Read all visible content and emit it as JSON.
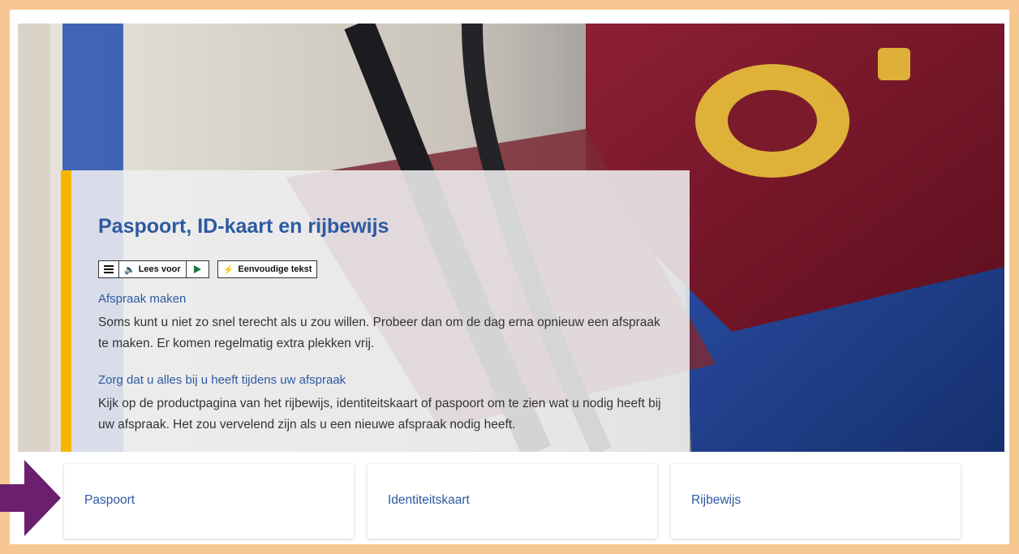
{
  "hero": {
    "title": "Paspoort, ID-kaart en rijbewijs",
    "toolbar": {
      "menu_icon": "menu-icon",
      "read_aloud_label": "Lees voor",
      "speaker_icon": "speaker-icon",
      "play_icon": "play-icon",
      "simple_text_label": "Eenvoudige tekst",
      "bolt_icon": "bolt-icon"
    },
    "sections": [
      {
        "heading": "Afspraak maken",
        "text": "Soms kunt u niet zo snel terecht als u zou willen. Probeer dan om de dag erna opnieuw een afspraak te maken. Er komen regelmatig extra plekken vrij."
      },
      {
        "heading": "Zorg dat u alles bij u heeft tijdens uw afspraak",
        "text": "Kijk op de productpagina van het rijbewijs, identiteitskaart of paspoort om te zien wat u nodig heeft bij uw afspraak. Het zou vervelend zijn als u een nieuwe afspraak nodig heeft."
      }
    ]
  },
  "tiles": [
    {
      "label": "Paspoort"
    },
    {
      "label": "Identiteitskaart"
    },
    {
      "label": "Rijbewijs"
    }
  ],
  "colors": {
    "frame": "#f7c791",
    "accent_bar": "#f6b400",
    "link": "#2c5aa0",
    "arrow": "#6b1f6e",
    "passport": "#7a1a2a"
  }
}
